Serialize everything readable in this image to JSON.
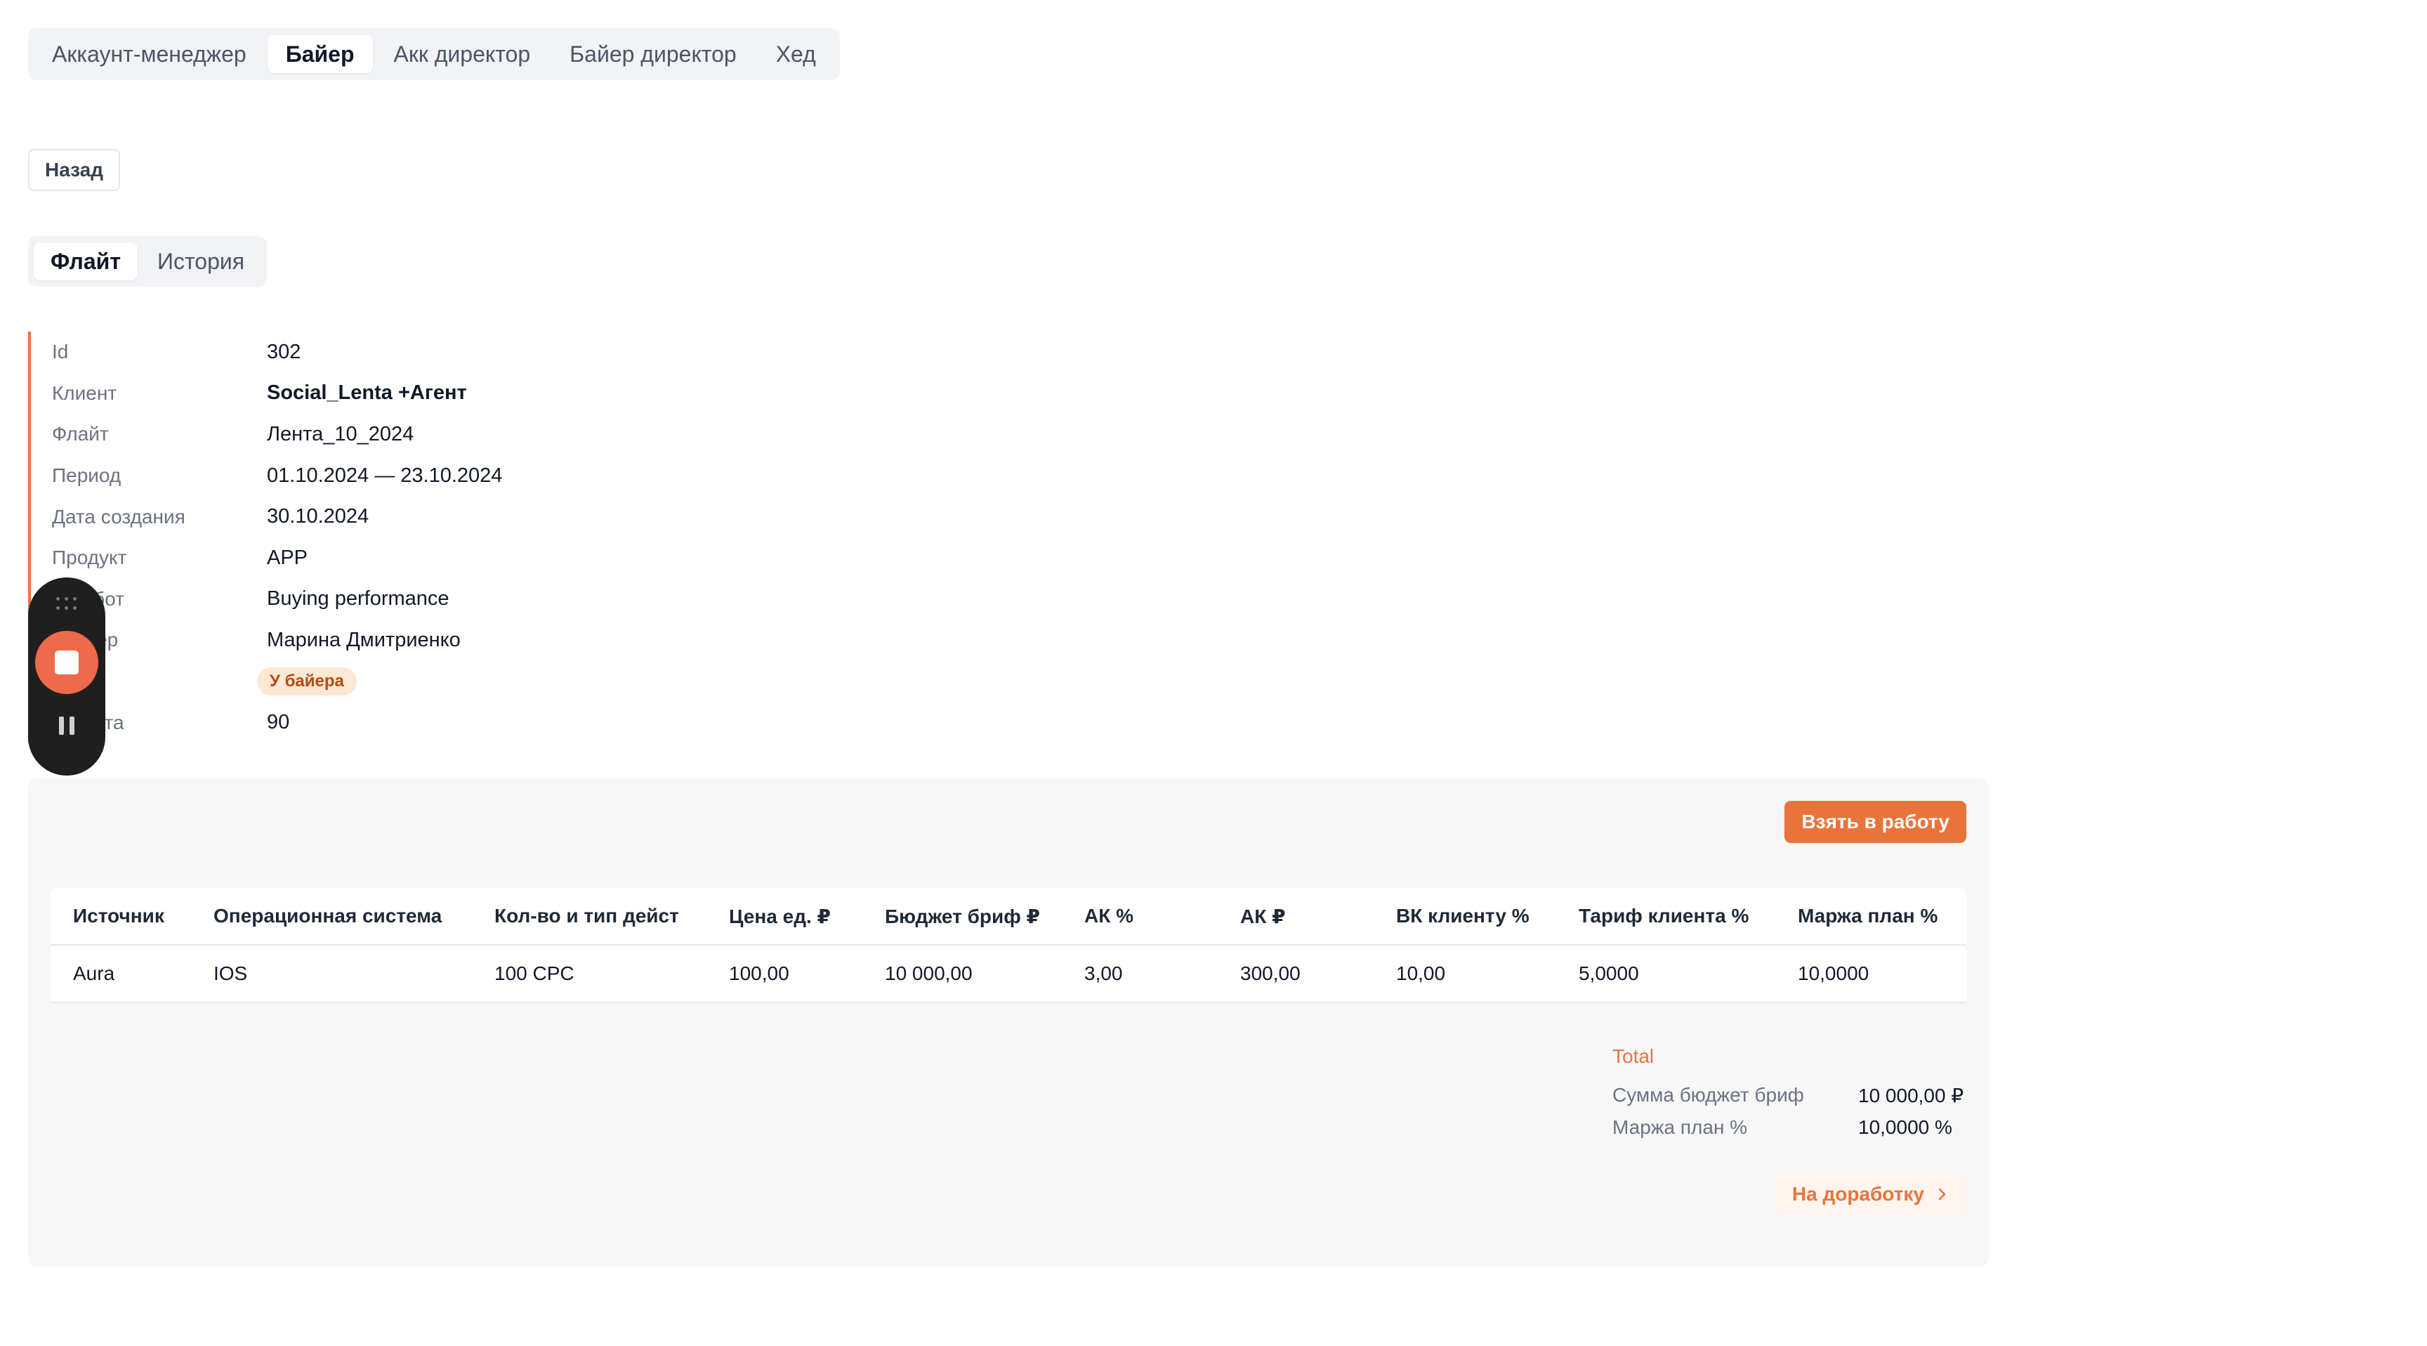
{
  "role_tabs": [
    {
      "label": "Аккаунт-менеджер"
    },
    {
      "label": "Байер",
      "active": true
    },
    {
      "label": "Акк директор"
    },
    {
      "label": "Байер директор"
    },
    {
      "label": "Хед"
    }
  ],
  "back_button": "Назад",
  "section_tabs": [
    {
      "label": "Флайт",
      "active": true
    },
    {
      "label": "История"
    }
  ],
  "info": [
    {
      "label": "Id",
      "value": "302"
    },
    {
      "label": "Клиент",
      "value": "Social_Lenta +Агент"
    },
    {
      "label": "Флайт",
      "value": "Лента_10_2024"
    },
    {
      "label": "Период",
      "value": "01.10.2024 — 23.10.2024"
    },
    {
      "label": "Дата создания",
      "value": "30.10.2024"
    },
    {
      "label": "Продукт",
      "value": "APP"
    },
    {
      "label": "…работ",
      "value": "Buying performance"
    },
    {
      "label": "…джер",
      "value": "Марина Дмитриенко"
    },
    {
      "label": "…с",
      "value": "У байера"
    },
    {
      "label": "…плата",
      "value": "90"
    }
  ],
  "take_button": "Взять в работу",
  "table": {
    "headers": [
      "Источник",
      "Операционная система",
      "Кол-во и тип дейст",
      "Цена ед. ₽",
      "Бюджет бриф ₽",
      "АК %",
      "АК ₽",
      "ВК клиенту %",
      "Тариф клиента %",
      "Маржа план %"
    ],
    "rows": [
      [
        "Aura",
        "IOS",
        "100 CPC",
        "100,00",
        "10 000,00",
        "3,00",
        "300,00",
        "10,00",
        "5,0000",
        "10,0000"
      ]
    ]
  },
  "totals": {
    "title": "Total",
    "rows": [
      {
        "label": "Сумма бюджет бриф",
        "value": "10 000,00 ₽"
      },
      {
        "label": "Маржа план %",
        "value": "10,0000 %"
      }
    ]
  },
  "rework_button": "На доработку",
  "colors": {
    "accent": "#e8743b",
    "status_badge_bg": "#fde8d4",
    "recorder_stop": "#ee6a4a"
  }
}
